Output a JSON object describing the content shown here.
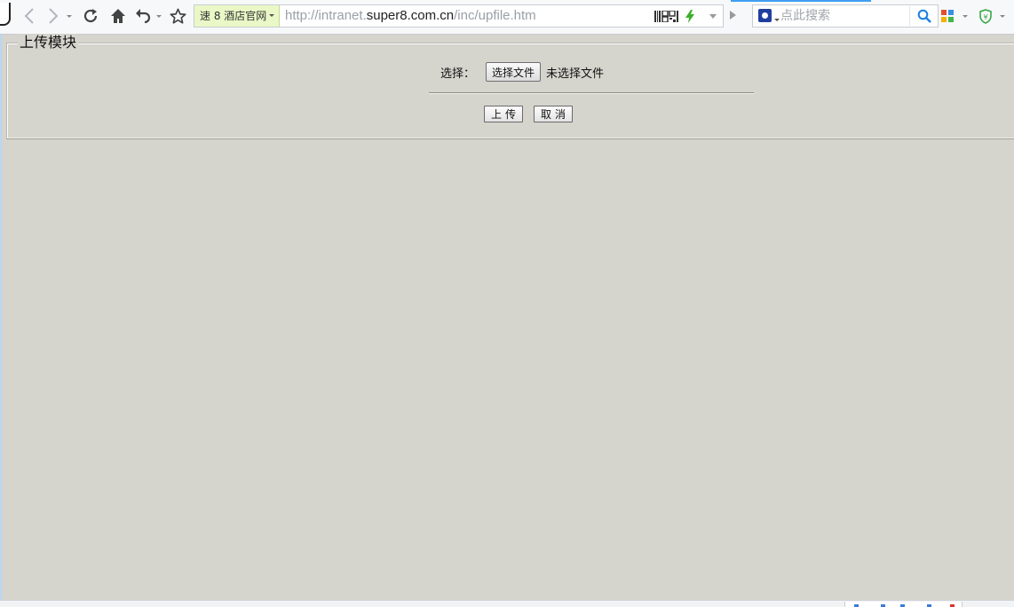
{
  "browser": {
    "site_tag": "速 8 酒店官网",
    "url_prefix": "http://intranet.",
    "url_domain": "super8.com.cn",
    "url_path": "/inc/upfile.htm",
    "search_placeholder": "点此搜索",
    "icons": [
      "back-icon",
      "forward-icon",
      "refresh-icon",
      "home-icon",
      "undo-icon",
      "star-icon",
      "qr-code-icon",
      "lightning-icon",
      "search-icon",
      "apps-icon",
      "shield-icon"
    ]
  },
  "upload": {
    "legend": "上传模块",
    "choose_label": "选择：",
    "choose_button": "选择文件",
    "no_file_text": "未选择文件",
    "upload_button": "上传",
    "cancel_button": "取消"
  },
  "colors": {
    "page_background": "#d5d4cd",
    "accent": "#3f9ef2"
  }
}
